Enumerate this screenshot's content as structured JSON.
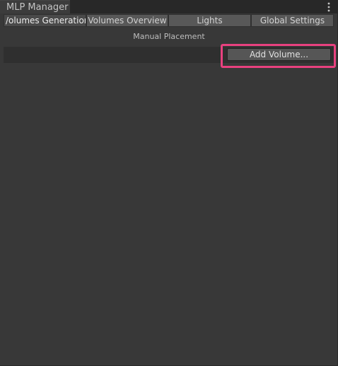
{
  "window": {
    "title": "MLP Manager",
    "menu_icon": "kebab-menu-icon"
  },
  "tabs": [
    {
      "label": "/olumes Generatior",
      "active": true
    },
    {
      "label": "Volumes Overview",
      "active": false
    },
    {
      "label": "Lights",
      "active": false
    },
    {
      "label": "Global Settings",
      "active": false
    }
  ],
  "main": {
    "section_label": "Manual Placement",
    "add_button_label": "Add Volume..."
  },
  "colors": {
    "highlight": "#e8417f",
    "background": "#383838"
  }
}
